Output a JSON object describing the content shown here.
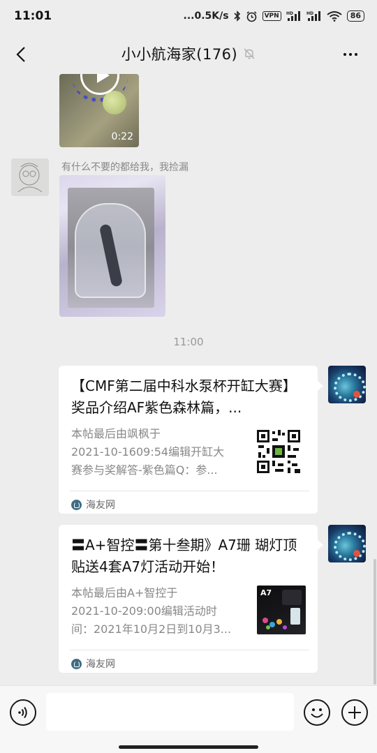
{
  "status_bar": {
    "time": "11:01",
    "network_speed": "...0.5K/s",
    "vpn_label": "VPN",
    "hd_label": "HD",
    "battery": "86"
  },
  "header": {
    "title": "小小航海家(176)"
  },
  "messages": {
    "video": {
      "duration": "0:22"
    },
    "image_caption": "有什么不要的都给我，我捡漏",
    "time_divider": "11:00",
    "cards": [
      {
        "title": "【CMF第二届中科水泵杯开缸大赛】奖品介绍AF紫色森林篇，...",
        "desc_lines": [
          "本帖最后由飒枫于",
          "2021-10-1609:54编辑开缸大",
          "赛参与奖解答-紫色篇Q：参..."
        ],
        "source": "海友网",
        "thumb_icon": "qr-code-icon"
      },
      {
        "title": "〓A+智控〓第十叁期》A7珊 瑚灯顶贴送4套A7灯活动开始！",
        "desc_lines": [
          "本帖最后由A+智控于",
          "2021-10-209:00编辑活动时",
          "间：2021年10月2日到10月3..."
        ],
        "source": "海友网",
        "thumb_label": "A7"
      }
    ]
  },
  "input_bar": {
    "placeholder": ""
  }
}
